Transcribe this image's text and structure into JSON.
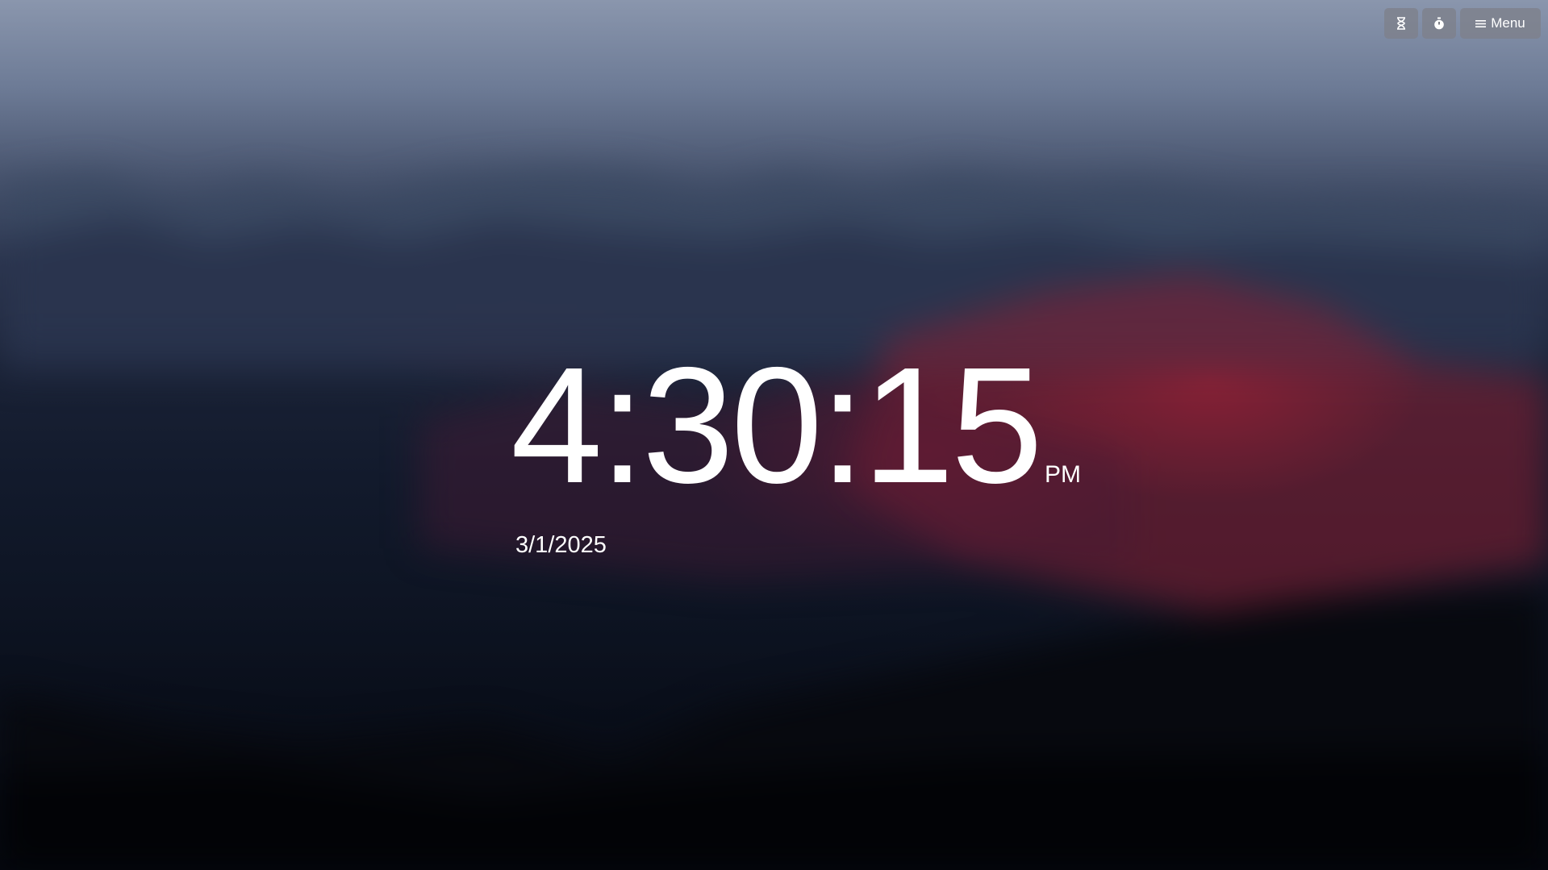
{
  "toolbar": {
    "timer_icon": "hourglass-icon",
    "stopwatch_icon": "stopwatch-icon",
    "menu_icon": "hamburger-icon",
    "menu_label": "Menu"
  },
  "clock": {
    "time": "4:30:15",
    "ampm": "PM",
    "date": "3/1/2025"
  },
  "colors": {
    "text": "#ffffff",
    "button_bg": "#7d808a"
  }
}
